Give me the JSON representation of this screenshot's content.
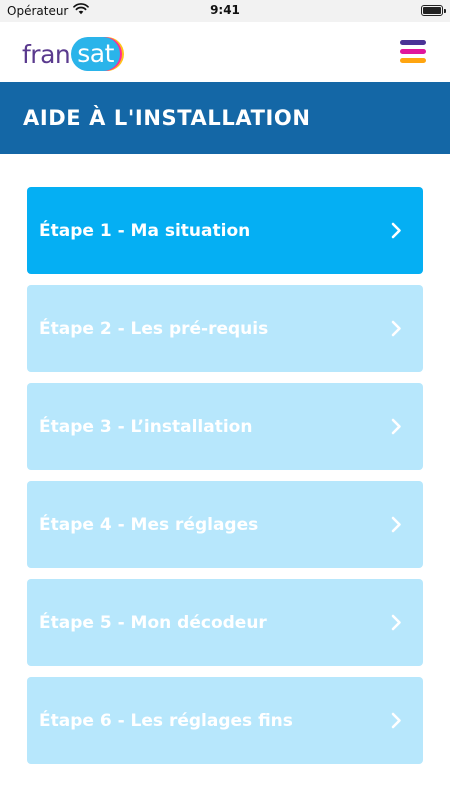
{
  "status": {
    "carrier": "Opérateur",
    "time": "9:41"
  },
  "header": {
    "logo_left": "fran",
    "logo_right": "sat"
  },
  "banner": {
    "title": "AIDE À L'INSTALLATION"
  },
  "steps": [
    {
      "label": "Étape 1 - Ma situation",
      "active": true
    },
    {
      "label": "Étape 2 - Les pré-requis",
      "active": false
    },
    {
      "label": "Étape 3 - L’installation",
      "active": false
    },
    {
      "label": "Étape 4 - Mes réglages",
      "active": false
    },
    {
      "label": "Étape 5 - Mon décodeur",
      "active": false
    },
    {
      "label": "Étape 6 - Les réglages fins",
      "active": false
    }
  ],
  "colors": {
    "banner": "#1467a6",
    "step_active": "#05aff3",
    "step_inactive": "#b7e7fc",
    "status_bar": "#f2f2f2"
  },
  "icons": {
    "status": [
      "wifi-icon",
      "battery-icon"
    ],
    "header": [
      "hamburger-menu-icon"
    ],
    "step": "chevron-right-icon"
  }
}
